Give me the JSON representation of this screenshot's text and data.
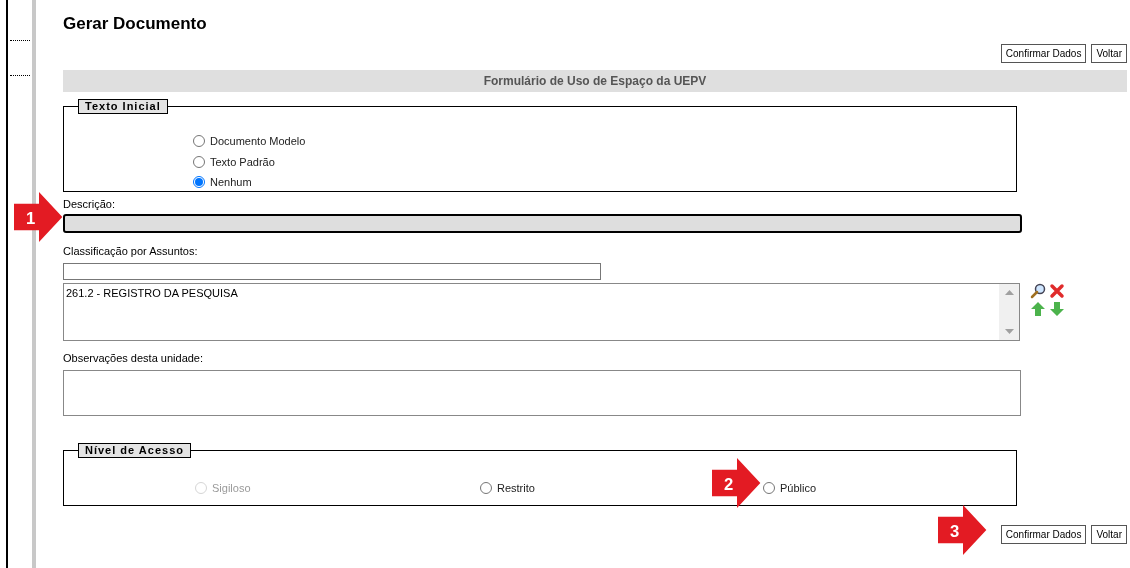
{
  "page_title": "Gerar Documento",
  "top_buttons": [
    "Confirmar Dados",
    "Voltar"
  ],
  "form_title": "Formulário de Uso de Espaço da UEPV",
  "texto_inicial": {
    "legend": "Texto Inicial",
    "options": [
      {
        "label": "Documento Modelo",
        "selected": false,
        "disabled": false
      },
      {
        "label": "Texto Padrão",
        "selected": false,
        "disabled": false
      },
      {
        "label": "Nenhum",
        "selected": true,
        "disabled": false
      }
    ]
  },
  "descricao": {
    "label": "Descrição:",
    "focused": true
  },
  "classificacao": {
    "label": "Classificação por Assuntos:",
    "items": [
      "261.2 - REGISTRO DA PESQUISA"
    ]
  },
  "observacoes": {
    "label": "Observações desta unidade:"
  },
  "nivel_acesso": {
    "legend": "Nível de Acesso",
    "options": [
      {
        "label": "Sigiloso",
        "selected": false,
        "disabled": true
      },
      {
        "label": "Restrito",
        "selected": false,
        "disabled": false
      },
      {
        "label": "Público",
        "selected": false,
        "disabled": false
      }
    ]
  },
  "bottom_buttons": [
    "Confirmar Dados",
    "Voltar"
  ],
  "callouts": [
    {
      "number": "1"
    },
    {
      "number": "2"
    },
    {
      "number": "3"
    }
  ]
}
